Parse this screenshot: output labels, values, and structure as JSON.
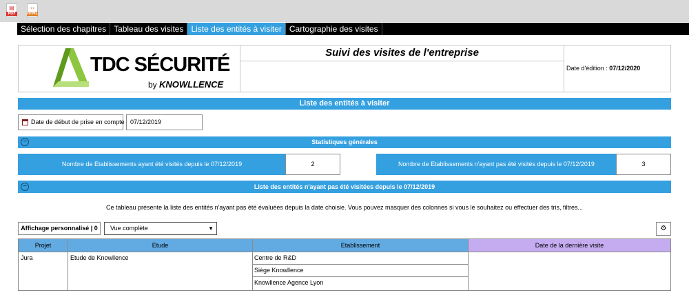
{
  "toolbar": {
    "pdf_label": "PDF",
    "html_label": "HTML"
  },
  "nav": {
    "tabs": [
      {
        "label": "Sélection des chapitres"
      },
      {
        "label": "Tableau des visites"
      },
      {
        "label": "Liste des entités à visiter"
      },
      {
        "label": "Cartographie des visites"
      }
    ],
    "active_index": 2
  },
  "header": {
    "logo_main": "TDC SÉCURITÉ",
    "logo_by": "by ",
    "logo_brand": "KNOWLLENCE",
    "title": "Suivi des visites de l'entreprise",
    "edition_label": "Date d'édition : ",
    "edition_date": "07/12/2020"
  },
  "section_title": "Liste des entités à visiter",
  "start_date": {
    "label": "Date de début de prise en compte",
    "value": "07/12/2019"
  },
  "stats": {
    "title": "Statistiques générales",
    "collapse_symbol": "−",
    "visited_label": "Nombre de Etablissements ayant été visités depuis le 07/12/2019",
    "visited_value": "2",
    "not_visited_label": "Nombre de Etablissements n'ayant pas été visités depuis le 07/12/2019",
    "not_visited_value": "3"
  },
  "list": {
    "title": "Liste des entités n'ayant pas été visitées depuis le 07/12/2019",
    "collapse_symbol": "−",
    "description": "Ce tableau présente la liste des entités n'ayant pas été évaluées depuis la date choisie. Vous pouvez masquer des colonnes si vous le souhaitez ou effectuer des tris, filtres...",
    "custom_view_button": "Affichage personnalisé | 0",
    "view_select": "Vue complète",
    "gear_symbol": "⚙",
    "columns": [
      "Projet",
      "Etude",
      "Etablissement",
      "Date de la dernière visite"
    ],
    "rows": [
      {
        "projet": "Jura",
        "etude": "Etude de Knowllence",
        "etablissements": [
          "Centre de R&D",
          "Siège Knowllence",
          "Knowllence Agence Lyon"
        ],
        "date": ""
      }
    ]
  },
  "colors": {
    "accent": "#35a0e0",
    "header_blue": "#62aae2",
    "header_purple": "#c5acf1",
    "logo_green": "#8dc63f"
  }
}
